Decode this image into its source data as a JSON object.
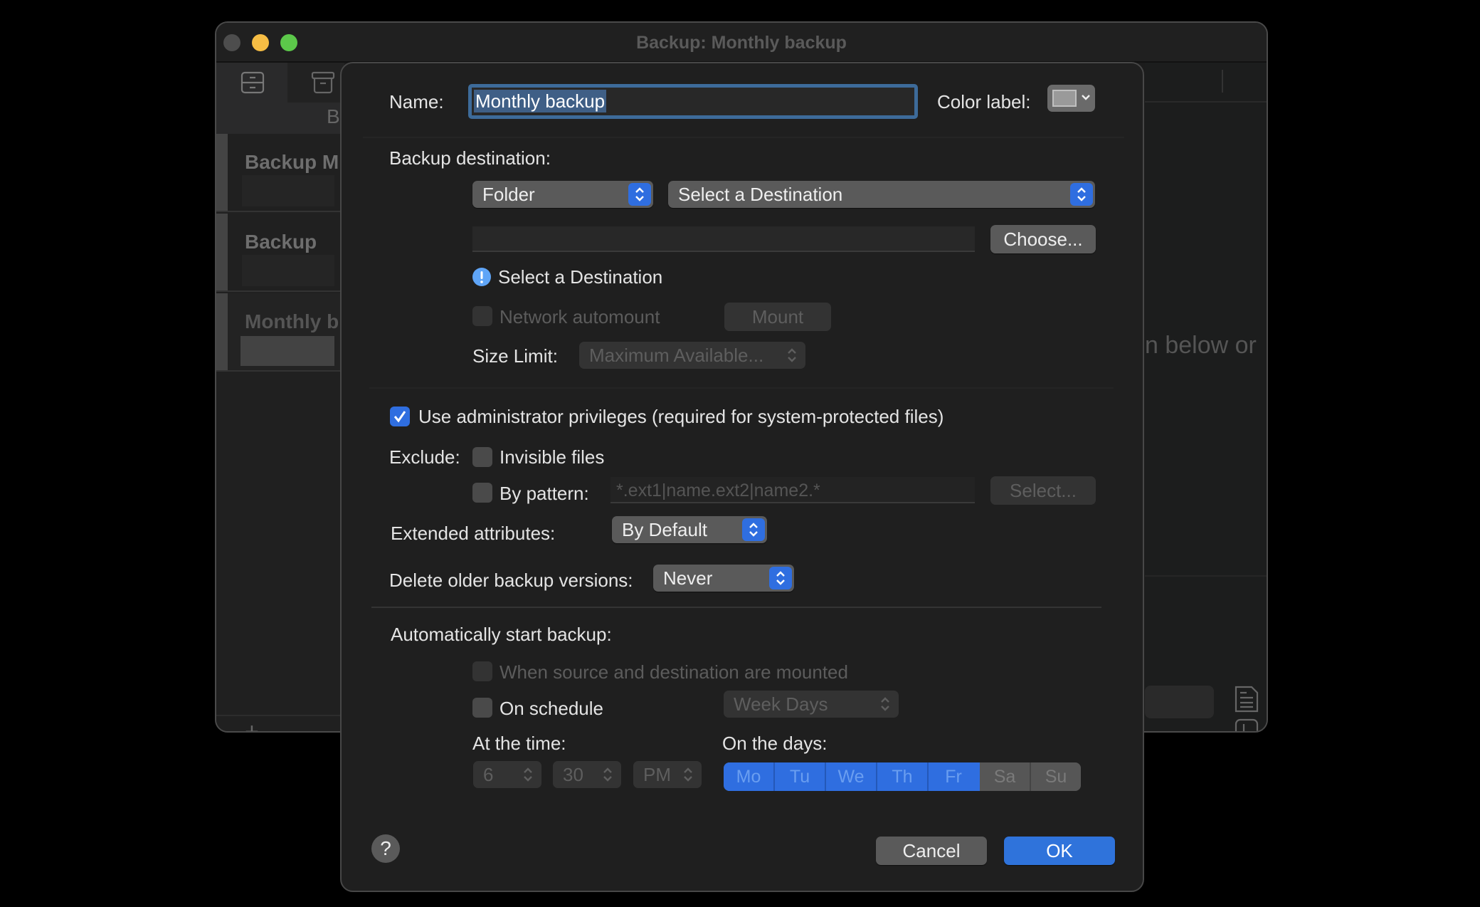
{
  "window": {
    "title": "Backup: Monthly backup",
    "traffic_lights": {
      "close": "#4d4d4d",
      "minimize": "#f6bd44",
      "zoom": "#5cc84a"
    },
    "sidebar": {
      "tab_partial_label": "B",
      "items": [
        {
          "title": "Backup M"
        },
        {
          "title": "Backup"
        },
        {
          "title": "Monthly b"
        }
      ],
      "add_label": "+",
      "remove_label": "—"
    },
    "content_hint_partial": "n below or"
  },
  "dialog": {
    "name_label": "Name:",
    "name_value": "Monthly backup",
    "color_label": "Color label:",
    "color_swatch": "#9a9a9a",
    "destination_label": "Backup destination:",
    "destination_type": "Folder",
    "destination_select": "Select a Destination",
    "path_value": "",
    "choose_button": "Choose...",
    "warning_text": "Select a Destination",
    "network_automount": "Network automount",
    "mount_button": "Mount",
    "size_limit_label": "Size Limit:",
    "size_limit_value": "Maximum Available...",
    "admin_privileges": "Use administrator privileges (required for system-protected files)",
    "admin_privileges_checked": true,
    "exclude_label": "Exclude:",
    "invisible_files": "Invisible files",
    "by_pattern": "By pattern:",
    "pattern_placeholder": "*.ext1|name.ext2|name2.*",
    "select_button": "Select...",
    "extended_attributes_label": "Extended attributes:",
    "extended_attributes_value": "By Default",
    "delete_older_label": "Delete older backup versions:",
    "delete_older_value": "Never",
    "auto_start_label": "Automatically start backup:",
    "when_mounted": "When source and destination are mounted",
    "on_schedule": "On schedule",
    "schedule_type": "Week Days",
    "at_time_label": "At the time:",
    "time_hour": "6",
    "time_minute": "30",
    "time_ampm": "PM",
    "on_days_label": "On the days:",
    "days": [
      {
        "label": "Mo",
        "selected": true
      },
      {
        "label": "Tu",
        "selected": true
      },
      {
        "label": "We",
        "selected": true
      },
      {
        "label": "Th",
        "selected": true
      },
      {
        "label": "Fr",
        "selected": true
      },
      {
        "label": "Sa",
        "selected": false
      },
      {
        "label": "Su",
        "selected": false
      }
    ],
    "help_label": "?",
    "cancel_button": "Cancel",
    "ok_button": "OK",
    "accent_color": "#2f6ee0"
  }
}
